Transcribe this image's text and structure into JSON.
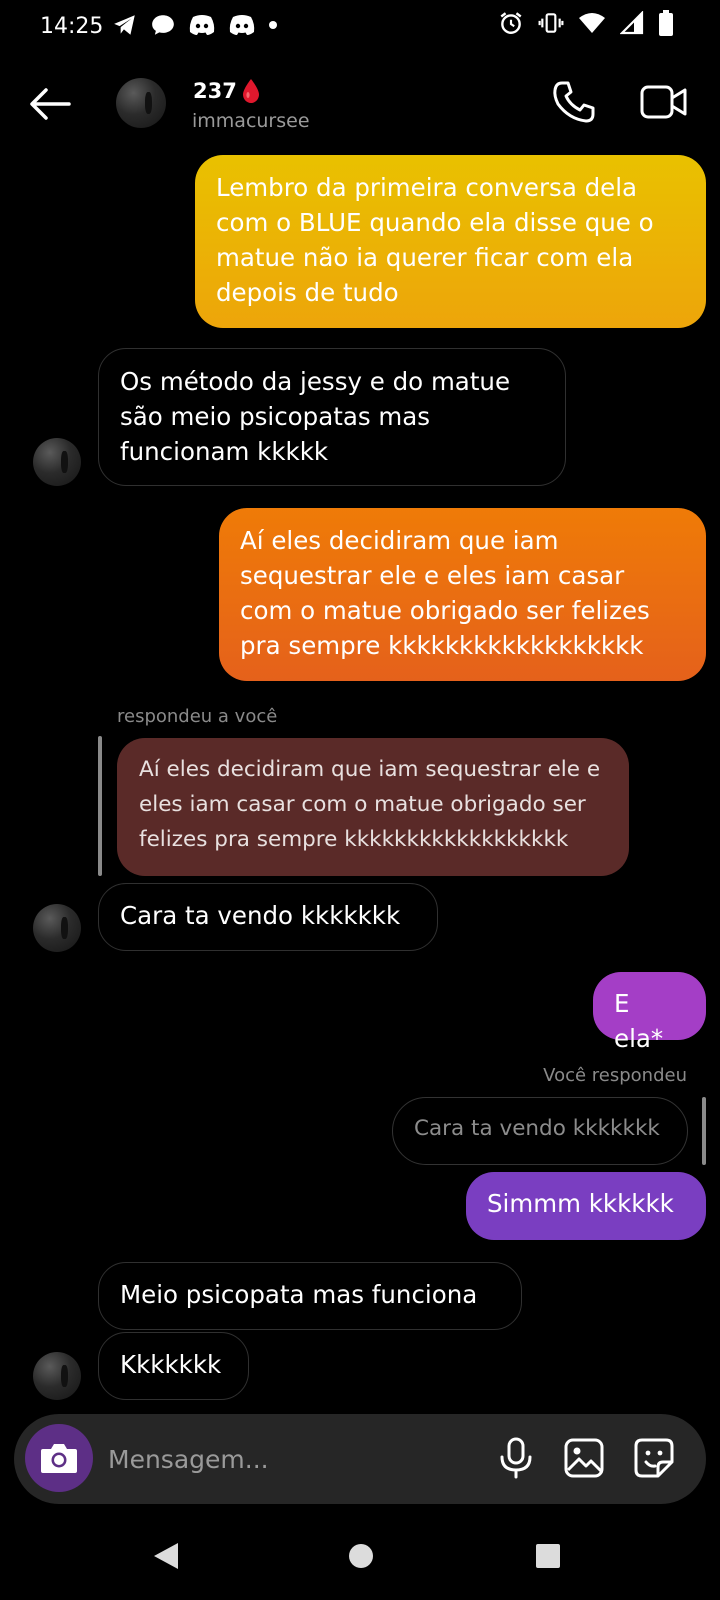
{
  "status_bar": {
    "time": "14:25",
    "left_icons": [
      "telegram-icon",
      "chat-bubble-icon",
      "discord-icon",
      "discord-icon",
      "dot-icon"
    ],
    "right_icons": [
      "alarm-icon",
      "vibrate-icon",
      "wifi-icon",
      "signal-icon",
      "battery-icon"
    ]
  },
  "header": {
    "contact_name": "237",
    "name_emoji": "blood-drop-icon",
    "contact_handle": "immacursee"
  },
  "messages": [
    {
      "side": "outgoing",
      "text": "Lembro da primeira conversa dela\ncom o BLUE quando ela disse que o\nmatue não ia querer ficar com ela\ndepois de tudo"
    },
    {
      "side": "incoming",
      "text": "Os método da jessy e do matue\nsão meio psicopatas mas\nfuncionam kkkkk"
    },
    {
      "side": "outgoing",
      "text": "Aí eles decidiram que iam\nsequestrar ele e eles iam casar\ncom o matue obrigado ser felizes\npra sempre kkkkkkkkkkkkkkkkkk"
    },
    {
      "side": "incoming",
      "reply_label": "respondeu a você",
      "quoted_text": "Aí eles decidiram que iam sequestrar ele e\neles iam casar com o matue obrigado ser\nfelizes pra sempre kkkkkkkkkkkkkkkkkk",
      "text": "Cara ta vendo kkkkkkk"
    },
    {
      "side": "outgoing",
      "text": "E ela*"
    },
    {
      "side": "outgoing",
      "reply_label": "Você respondeu",
      "quoted_text": "Cara ta vendo kkkkkkk",
      "text": "Simmm kkkkkk"
    },
    {
      "side": "incoming",
      "text": "Meio psicopata mas funciona"
    },
    {
      "side": "incoming",
      "text": "Kkkkkkk"
    }
  ],
  "composer": {
    "placeholder": "Mensagem..."
  },
  "colors": {
    "bubble_yellow": "#e9c100",
    "bubble_orange": "#ef7b07",
    "quoted_reply": "#5a2a28",
    "bubble_purple": "#a43ec6",
    "bubble_violet": "#7a3ec1",
    "camera_button": "#5d2f86",
    "blood_drop": "#e0182d"
  }
}
